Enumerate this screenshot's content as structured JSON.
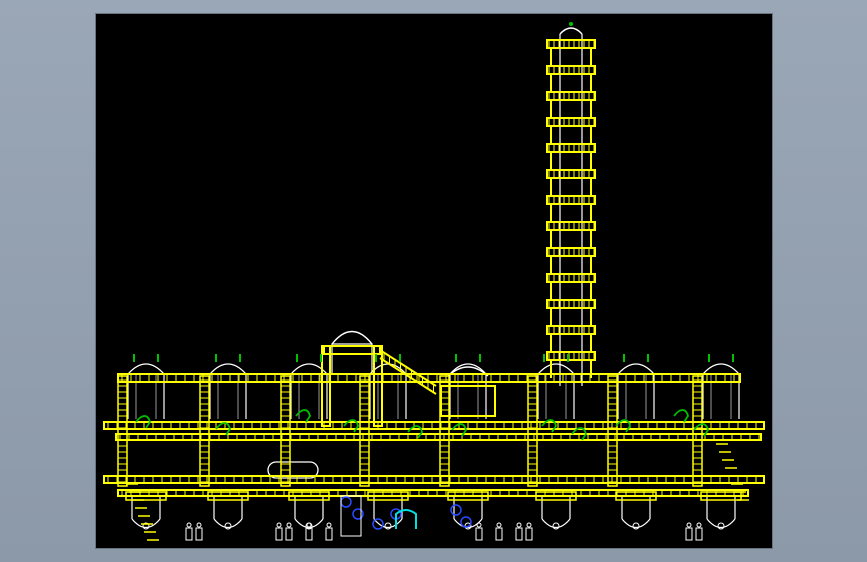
{
  "canvas": {
    "background": "#000000",
    "frame_color": "#9aa7b6",
    "text": ""
  },
  "drawing": {
    "subject": "plant elevation",
    "colors": {
      "steel": "#ffff00",
      "vessel": "#ffffff",
      "valve": "#00c000",
      "instrument": "#2a4bff",
      "pipe": "#00e0e0"
    },
    "vessel_count": 7,
    "platform_levels": 3,
    "tower_sections": 13
  }
}
